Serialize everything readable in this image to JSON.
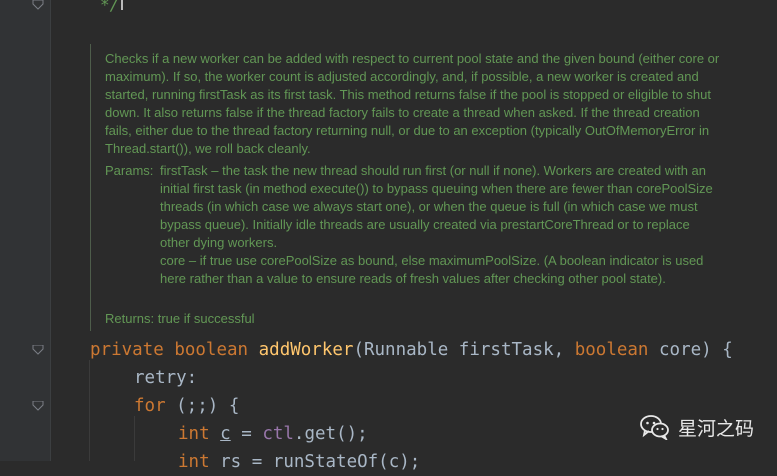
{
  "editor": {
    "comment_close": "*/",
    "doc": {
      "description": "Checks if a new worker can be added with respect to current pool state and the given bound (either core or maximum). If so, the worker count is adjusted accordingly, and, if possible, a new worker is created and started, running firstTask as its first task. This method returns false if the pool is stopped or eligible to shut down. It also returns false if the thread factory fails to create a thread when asked. If the thread creation fails, either due to the thread factory returning null, or due to an exception (typically OutOfMemoryError in Thread.start()), we roll back cleanly.",
      "params_label": "Params:",
      "param_first_task": "firstTask – the task the new thread should run first (or null if none). Workers are created with an initial first task (in method execute()) to bypass queuing when there are fewer than corePoolSize threads (in which case we always start one), or when the queue is full (in which case we must bypass queue). Initially idle threads are usually created via prestartCoreThread or to replace other dying workers.",
      "param_core": "core – if true use corePoolSize as bound, else maximumPoolSize. (A boolean indicator is used here rather than a value to ensure reads of fresh values after checking other pool state).",
      "returns": "Returns: true if successful"
    },
    "code": {
      "l1": {
        "kw1": "private",
        "kw2": "boolean",
        "fn": "addWorker",
        "p1": "(Runnable firstTask, ",
        "kw3": "boolean",
        "p2": " core) {"
      },
      "l2": "retry:",
      "l3": {
        "kw": "for",
        "rest": " (;;) {"
      },
      "l4": {
        "kw": "int",
        "var": "c",
        "eq": " = ",
        "fld": "ctl",
        "rest": ".get();"
      },
      "l5": {
        "kw": "int",
        "rest": " rs = runStateOf(c);"
      }
    }
  },
  "watermark": {
    "icon": "wechat-icon",
    "text": "星河之码"
  }
}
